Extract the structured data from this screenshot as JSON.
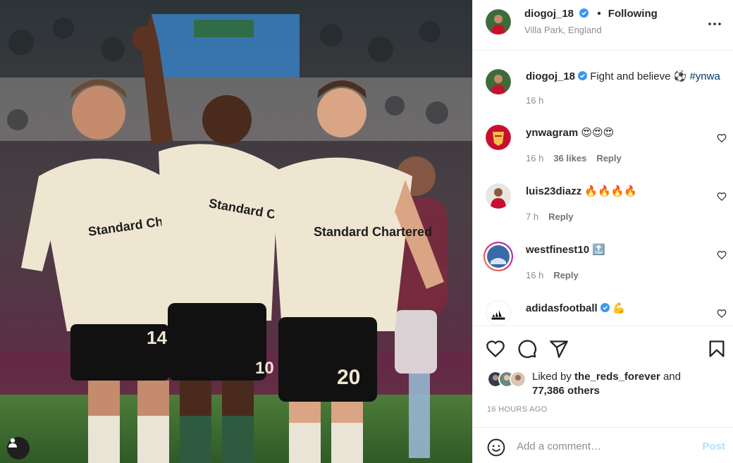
{
  "post": {
    "author": "diogoj_18",
    "follow_state": "Following",
    "dot": "•",
    "location": "Villa Park, England",
    "caption_text": "Fight and believe ⚽",
    "caption_hashtag": "#ynwa",
    "caption_time": "16 h",
    "liked_by_prefix": "Liked by",
    "liked_by_user": "the_reds_forever",
    "liked_by_and": "and",
    "liked_by_others": "77,386 others",
    "time_ago": "16 HOURS AGO"
  },
  "media": {
    "jersey_numbers": [
      "14",
      "10",
      "20"
    ],
    "sponsor_text": "Standard Chartered"
  },
  "comments": [
    {
      "user": "ynwagram",
      "text": "😍😍😍",
      "time": "16 h",
      "likes": "36 likes",
      "reply": "Reply",
      "verified": false
    },
    {
      "user": "luis23diazz",
      "text": "🔥🔥🔥🔥",
      "time": "7 h",
      "likes": "",
      "reply": "Reply",
      "verified": false
    },
    {
      "user": "westfinest10",
      "text": "🔝",
      "time": "16 h",
      "likes": "",
      "reply": "Reply",
      "verified": false
    },
    {
      "user": "adidasfootball",
      "text": "💪",
      "time": "",
      "likes": "",
      "reply": "",
      "verified": true
    }
  ],
  "comment_input": {
    "placeholder": "Add a comment…",
    "post_label": "Post"
  },
  "icons": {
    "more": "more-options-icon",
    "like": "heart-icon",
    "comment": "comment-icon",
    "share": "share-icon",
    "save": "bookmark-icon",
    "emoji": "emoji-icon",
    "verified": "verified-badge-icon",
    "user_tag": "user-tag-icon"
  },
  "colors": {
    "link": "#00376b",
    "verified": "#3897f0",
    "post_disabled": "#b2dffc",
    "secondary_text": "#8e8e8e"
  }
}
